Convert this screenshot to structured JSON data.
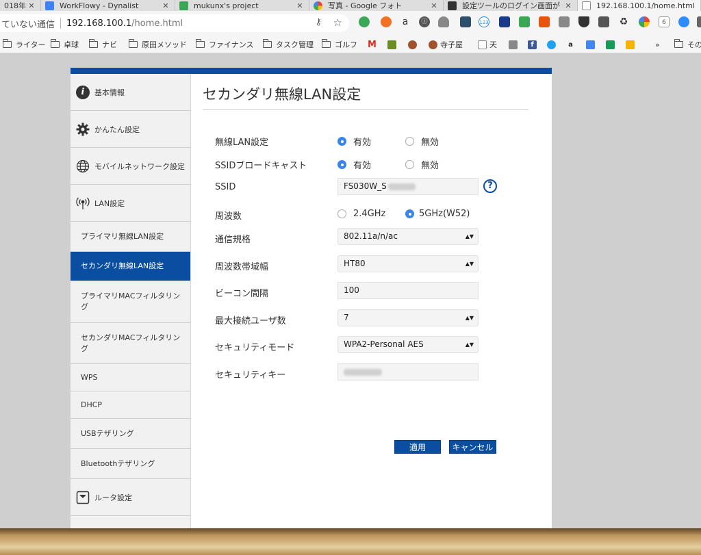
{
  "browser": {
    "tabs": [
      {
        "title": "018年",
        "icon_color": "#b0b0b0"
      },
      {
        "title": "WorkFlowy - Dynalist",
        "icon_color": "#3b82f6"
      },
      {
        "title": "mukunx's project",
        "icon_color": "#3aa757"
      },
      {
        "title": "写真 - Google フォト",
        "icon_color": "#ea4335"
      },
      {
        "title": "設定ツールのログイン画面が",
        "icon_color": "#333333"
      },
      {
        "title": "192.168.100.1/home.html",
        "icon_color": "#999999"
      }
    ],
    "close_glyph": "✕",
    "omnibox": {
      "security_text": "ていない通信",
      "host": "192.168.100.1",
      "path": "/home.html"
    },
    "extensions": [
      "evernote-icon",
      "refresh-icon",
      "amazon-icon",
      "info-icon",
      "cloud-icon",
      "camera-icon",
      "counter-icon",
      "flag-icon",
      "tag-icon",
      "bookmark-icon",
      "document-icon",
      "pocket-icon",
      "map-icon",
      "recycle-icon",
      "color-icon",
      "calendar-icon",
      "zoom-icon"
    ],
    "extension_texts": {
      "amazon": "a",
      "info": "ⓘ",
      "counter": "123",
      "calendar": "6"
    },
    "bookmarks": [
      {
        "label": "ライター",
        "type": "folder"
      },
      {
        "label": "卓球",
        "type": "folder"
      },
      {
        "label": "ナビ",
        "type": "folder"
      },
      {
        "label": "原田メソッド",
        "type": "folder"
      },
      {
        "label": "ファイナンス",
        "type": "folder"
      },
      {
        "label": "タスク管理",
        "type": "folder"
      },
      {
        "label": "ゴルフ",
        "type": "folder"
      },
      {
        "label": "寺子屋",
        "type": "site"
      },
      {
        "label": "天",
        "type": "site"
      },
      {
        "label": "その",
        "type": "folder"
      }
    ],
    "bookmark_texts": {
      "gmail": "M",
      "facebook": "f",
      "amazon": "a",
      "more": "»"
    }
  },
  "sidebar": {
    "items": [
      {
        "label": "基本情報",
        "icon": "info-icon"
      },
      {
        "label": "かんたん設定",
        "icon": "gear-icon"
      },
      {
        "label": "モバイルネットワーク設定",
        "icon": "globe-icon"
      },
      {
        "label": "LAN設定",
        "icon": "wireless-icon"
      },
      {
        "label": "プライマリ無線LAN設定"
      },
      {
        "label": "セカンダリ無線LAN設定",
        "selected": true
      },
      {
        "label": "プライマリMACフィルタリング"
      },
      {
        "label": "セカンダリMACフィルタリング"
      },
      {
        "label": "WPS"
      },
      {
        "label": "DHCP"
      },
      {
        "label": "USBテザリング"
      },
      {
        "label": "Bluetoothテザリング"
      },
      {
        "label": "ルータ設定",
        "icon": "router-icon"
      }
    ],
    "info_glyph": "i"
  },
  "form": {
    "title": "セカンダリ無線LAN設定",
    "wireless_lan": {
      "label": "無線LAN設定",
      "options": [
        "有効",
        "無効"
      ],
      "selected": "有効"
    },
    "ssid_broadcast": {
      "label": "SSIDブロードキャスト",
      "options": [
        "有効",
        "無効"
      ],
      "selected": "有効"
    },
    "ssid": {
      "label": "SSID",
      "value": "FS030W_S"
    },
    "help_glyph": "?",
    "frequency": {
      "label": "周波数",
      "options": [
        "2.4GHz",
        "5GHz(W52)"
      ],
      "selected": "5GHz(W52)"
    },
    "standard": {
      "label": "通信規格",
      "value": "802.11a/n/ac"
    },
    "bandwidth": {
      "label": "周波数帯域幅",
      "value": "HT80"
    },
    "beacon": {
      "label": "ビーコン間隔",
      "value": "100"
    },
    "max_users": {
      "label": "最大接続ユーザ数",
      "value": "7"
    },
    "security_mode": {
      "label": "セキュリティモード",
      "value": "WPA2-Personal AES"
    },
    "security_key": {
      "label": "セキュリティキー",
      "value": ""
    },
    "caret_glyph": "▲▼",
    "apply_label": "適用",
    "cancel_label": "キャンセル"
  },
  "colors": {
    "brand_blue": "#0a4ea1",
    "radio_on": "#3a86e8"
  }
}
